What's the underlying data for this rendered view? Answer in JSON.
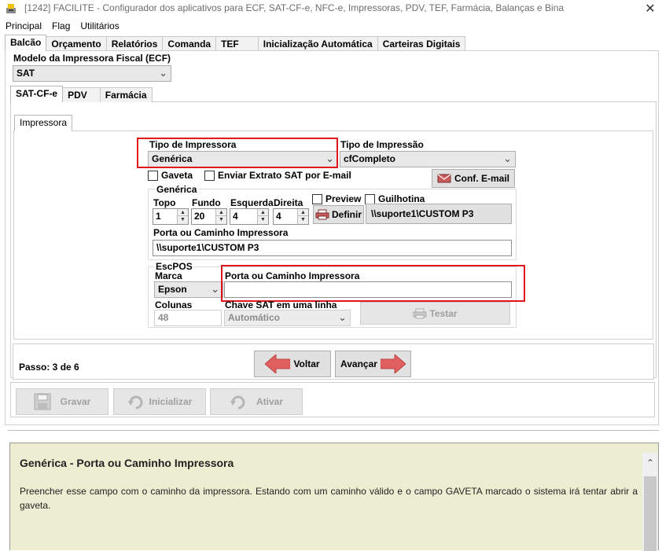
{
  "window": {
    "title": "[1242] FACILITE - Configurador dos aplicativos para ECF, SAT-CF-e, NFC-e, Impressoras, PDV, TEF, Farmácia, Balanças e Bina",
    "close": "✕"
  },
  "menu": [
    "Principal",
    "Flag",
    "Utilitários"
  ],
  "main_tabs": [
    "Balcão",
    "Orçamento",
    "Relatórios",
    "Comanda",
    "TEF",
    "Inicialização Automática",
    "Carteiras Digitais"
  ],
  "printer_model": {
    "label": "Modelo da Impressora Fiscal (ECF)",
    "value": "SAT"
  },
  "sub_tabs": [
    "SAT-CF-e",
    "PDV",
    "Farmácia"
  ],
  "inner_tab": "Impressora",
  "tipo_impressora": {
    "label": "Tipo de Impressora",
    "value": "Genérica"
  },
  "tipo_impressao": {
    "label": "Tipo de Impressão",
    "value": "cfCompleto"
  },
  "gaveta_label": "Gaveta",
  "enviar_extrato_label": "Enviar Extrato SAT por E-mail",
  "conf_email_label": "Conf. E-mail",
  "generica": {
    "group_label": "Genérica",
    "topo_label": "Topo",
    "topo_value": "1",
    "fundo_label": "Fundo",
    "fundo_value": "20",
    "esquerda_label": "Esquerda",
    "esquerda_value": "4",
    "direita_label": "Direita",
    "direita_value": "4",
    "preview_label": "Preview",
    "guilhotina_label": "Guilhotina",
    "definir_label": "Definir",
    "printer_path_display": "\\\\suporte1\\CUSTOM P3",
    "porta_label": "Porta ou Caminho Impressora",
    "porta_value": "\\\\suporte1\\CUSTOM P3"
  },
  "escpos": {
    "group_label": "EscPOS",
    "marca_label": "Marca",
    "marca_value": "Epson",
    "porta_label": "Porta ou Caminho Impressora",
    "porta_value": "",
    "colunas_label": "Colunas",
    "colunas_value": "48",
    "chave_label": "Chave SAT em uma linha",
    "chave_value": "Automático",
    "testar_label": "Testar"
  },
  "step": {
    "text": "Passo: 3 de 6",
    "back_label": "Voltar",
    "next_label": "Avançar"
  },
  "actions": [
    "Gravar",
    "Inicializar",
    "Ativar"
  ],
  "help": {
    "title": "Genérica - Porta ou Caminho Impressora",
    "body": "Preencher esse campo com o caminho da impressora. Estando com um caminho válido e o campo GAVETA marcado o sistema irá tentar abrir a gaveta."
  },
  "colors": {
    "highlight": "#e0161c",
    "help_bg": "#ededd2",
    "arrow": "#e06060"
  }
}
